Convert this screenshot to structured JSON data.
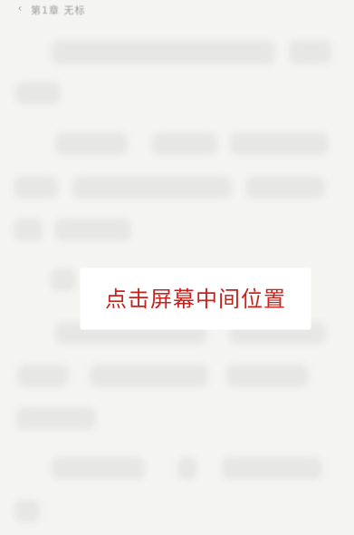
{
  "header": {
    "back_icon": "chevron-left-icon",
    "chapter_title": "第1章  无标"
  },
  "overlay": {
    "tip_text": "点击屏幕中间位置"
  },
  "colors": {
    "page_background": "#f4f4f2",
    "tip_background": "#ffffff",
    "tip_text": "#c8221d",
    "muted_text": "#9c9c9c"
  }
}
